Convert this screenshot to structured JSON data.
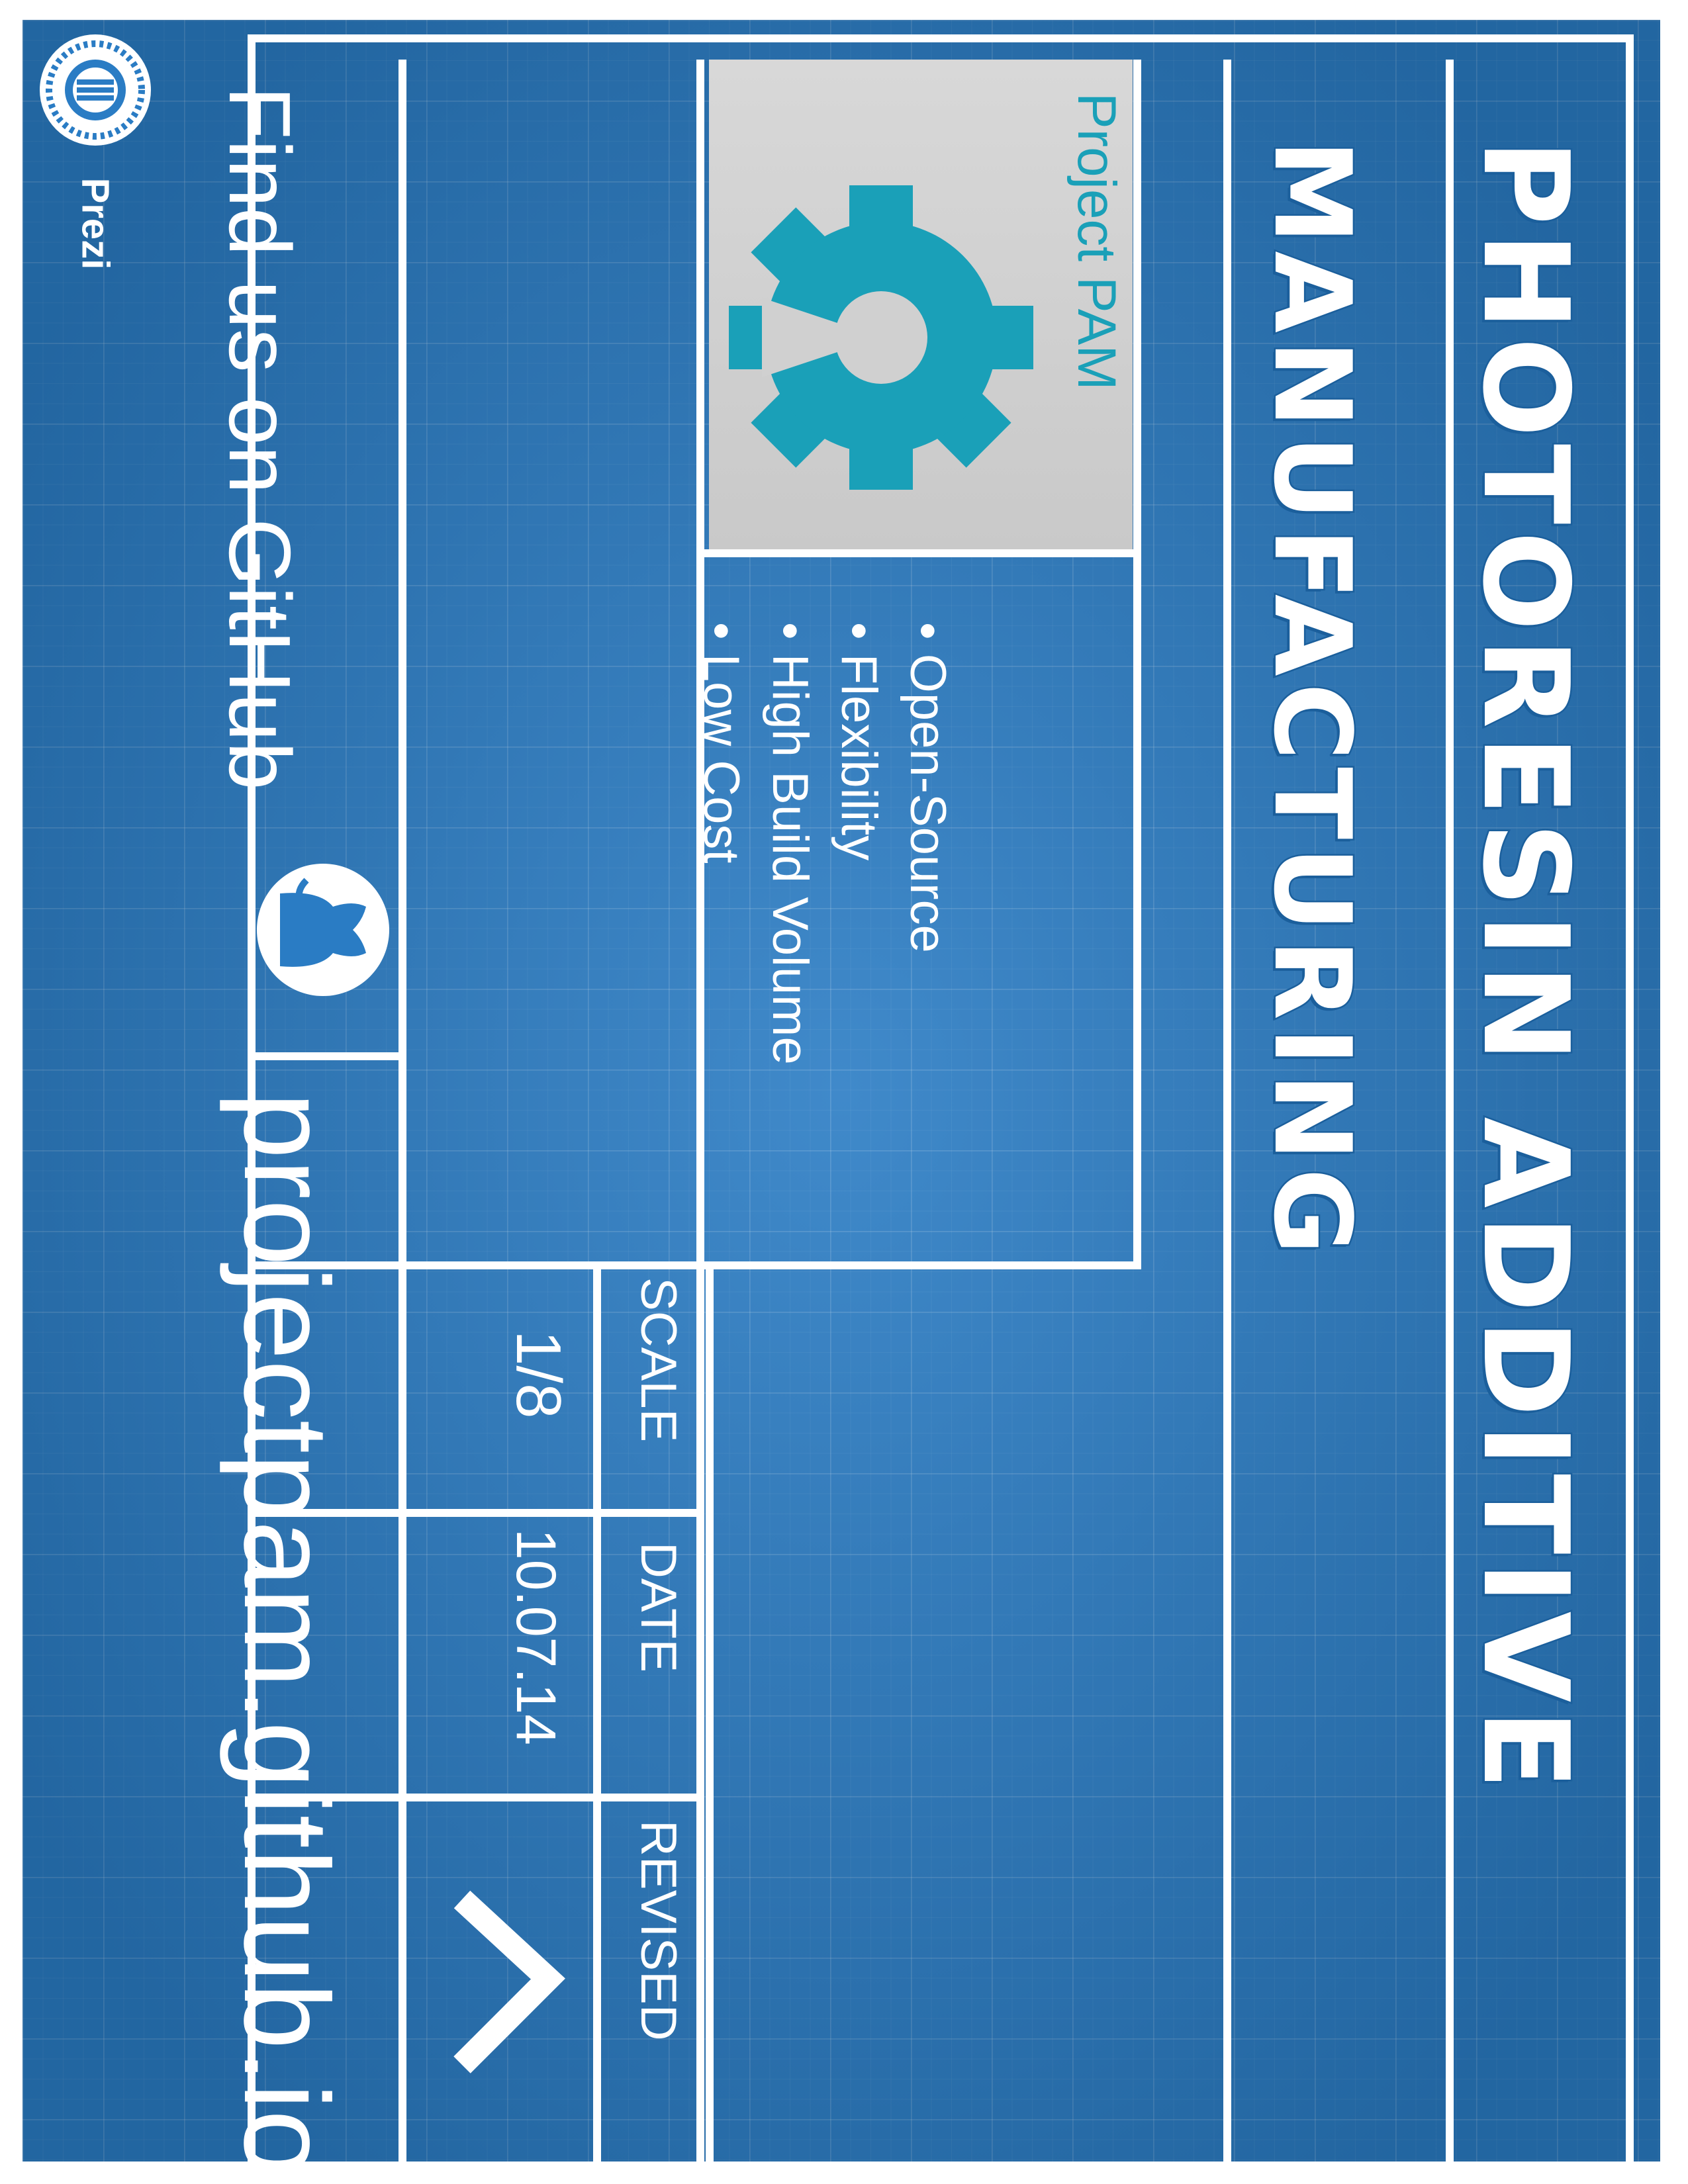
{
  "title": {
    "line1": "PHOTORESIN ADDITIVE",
    "line2": "MANUFACTURING"
  },
  "logo": {
    "name": "Project PAM",
    "icon": "gear-icon",
    "color": "#1aa0b8"
  },
  "features": [
    "Open-Source",
    "Flexibility",
    "High Build Volume",
    "Low Cost"
  ],
  "title_block": {
    "scale_label": "SCALE",
    "scale_value": "1/8",
    "date_label": "DATE",
    "date_value": "10.07.14",
    "revised_label": "REVISED",
    "revised_icon": "chevron-icon"
  },
  "footer": {
    "find_text": "Find us on GitHub",
    "github_icon": "github-icon",
    "url": "projectpam.github.io"
  },
  "brand": {
    "name": "Prezi",
    "icon": "prezi-logo-icon"
  },
  "colors": {
    "background": "#2a7cc4",
    "lines": "#ffffff",
    "accent": "#1aa0b8"
  }
}
